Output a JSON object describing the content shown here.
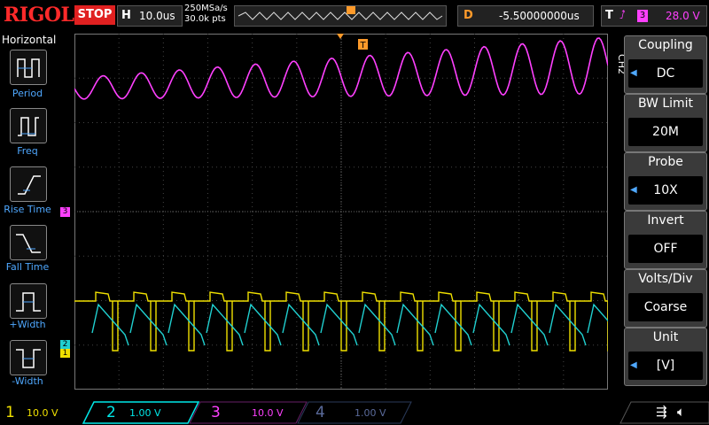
{
  "top": {
    "logo": "RIGOL",
    "run_state": "STOP",
    "h_label": "H",
    "timebase": "10.0us",
    "sample_rate": "250MSa/s",
    "mem_depth": "30.0k pts",
    "delay_label": "D",
    "delay": "-5.50000000us",
    "trig_label": "T",
    "trig_channel": "3",
    "trig_level": "28.0 V",
    "trig_marker": "T"
  },
  "left_menu": {
    "title": "Horizontal",
    "items": [
      {
        "label": "Period"
      },
      {
        "label": "Freq"
      },
      {
        "label": "Rise Time"
      },
      {
        "label": "Fall Time"
      },
      {
        "label": "+Width"
      },
      {
        "label": "-Width"
      }
    ]
  },
  "right_menu": {
    "channel_tag": "CH2",
    "items": [
      {
        "header": "Coupling",
        "value": "DC"
      },
      {
        "header": "BW Limit",
        "value": "20M"
      },
      {
        "header": "Probe",
        "value": "10X"
      },
      {
        "header": "Invert",
        "value": "OFF"
      },
      {
        "header": "Volts/Div",
        "value": "Coarse"
      },
      {
        "header": "Unit",
        "value": "[V]"
      }
    ]
  },
  "markers": {
    "ch3": "3",
    "ch2": "2",
    "ch1": "1"
  },
  "bottom": {
    "channels": [
      {
        "num": "1",
        "scale": "10.0 V",
        "color": "#f0e000"
      },
      {
        "num": "2",
        "scale": "1.00 V",
        "color": "#00e8e8"
      },
      {
        "num": "3",
        "scale": "10.0 V",
        "color": "#ff40ff"
      },
      {
        "num": "4",
        "scale": "1.00 V",
        "color": "#5a6a9a"
      }
    ]
  },
  "colors": {
    "ch1": "#f0e000",
    "ch2": "#20d0d0",
    "ch3": "#ff40ff",
    "trigger": "#ff9a2a",
    "accent": "#4fa8ff"
  }
}
